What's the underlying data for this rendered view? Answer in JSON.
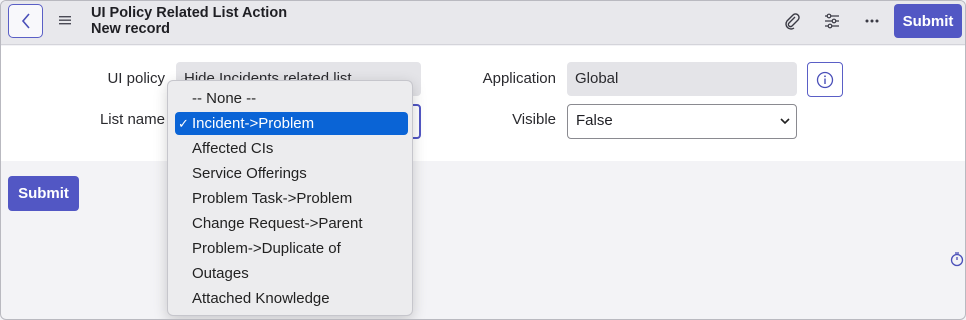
{
  "header": {
    "title": "UI Policy Related List Action",
    "subtitle": "New record",
    "submit_label": "Submit",
    "icons": [
      "back-icon",
      "menu-icon",
      "attachment-icon",
      "settings-sliders-icon",
      "more-icon"
    ]
  },
  "form": {
    "ui_policy_label": "UI policy",
    "ui_policy_value": "Hide Incidents related list",
    "list_name_label": "List name",
    "application_label": "Application",
    "application_value": "Global",
    "visible_label": "Visible",
    "visible_value": "False"
  },
  "dropdown": {
    "selected": "Incident->Problem",
    "options": [
      "-- None --",
      "Incident->Problem",
      "Affected CIs",
      "Service Offerings",
      "Problem Task->Problem",
      "Change Request->Parent",
      "Problem->Duplicate of",
      "Outages",
      "Attached Knowledge"
    ]
  },
  "footer": {
    "submit_label": "Submit"
  },
  "colors": {
    "accent": "#5257c4",
    "selection": "#0a64d6"
  }
}
